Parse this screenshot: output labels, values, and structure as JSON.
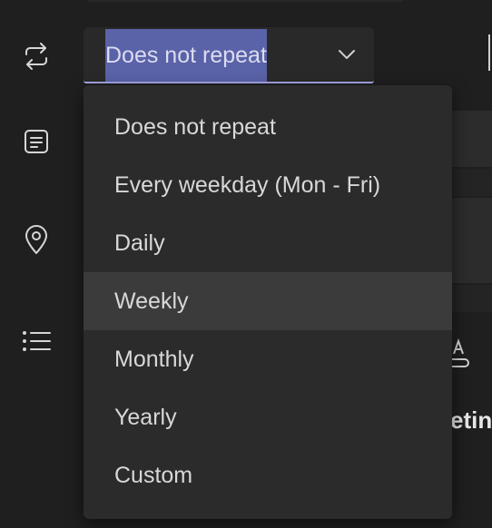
{
  "rail": {
    "icons": [
      "repeat-icon",
      "notes-icon",
      "location-icon",
      "list-icon"
    ]
  },
  "recurrence": {
    "selected_label": "Does not repeat",
    "options": [
      {
        "label": "Does not repeat"
      },
      {
        "label": "Every weekday (Mon - Fri)"
      },
      {
        "label": "Daily"
      },
      {
        "label": "Weekly"
      },
      {
        "label": "Monthly"
      },
      {
        "label": "Yearly"
      },
      {
        "label": "Custom"
      }
    ],
    "hovered_option": "Weekly"
  },
  "background": {
    "peek_text": "etin"
  },
  "colors": {
    "background": "#1f1f1f",
    "surface": "#2b2b2b",
    "selection_highlight": "#5a62a8",
    "focus_underline": "#a6a8e8",
    "hover": "#3b3b3b",
    "text": "#d8d8d8"
  }
}
